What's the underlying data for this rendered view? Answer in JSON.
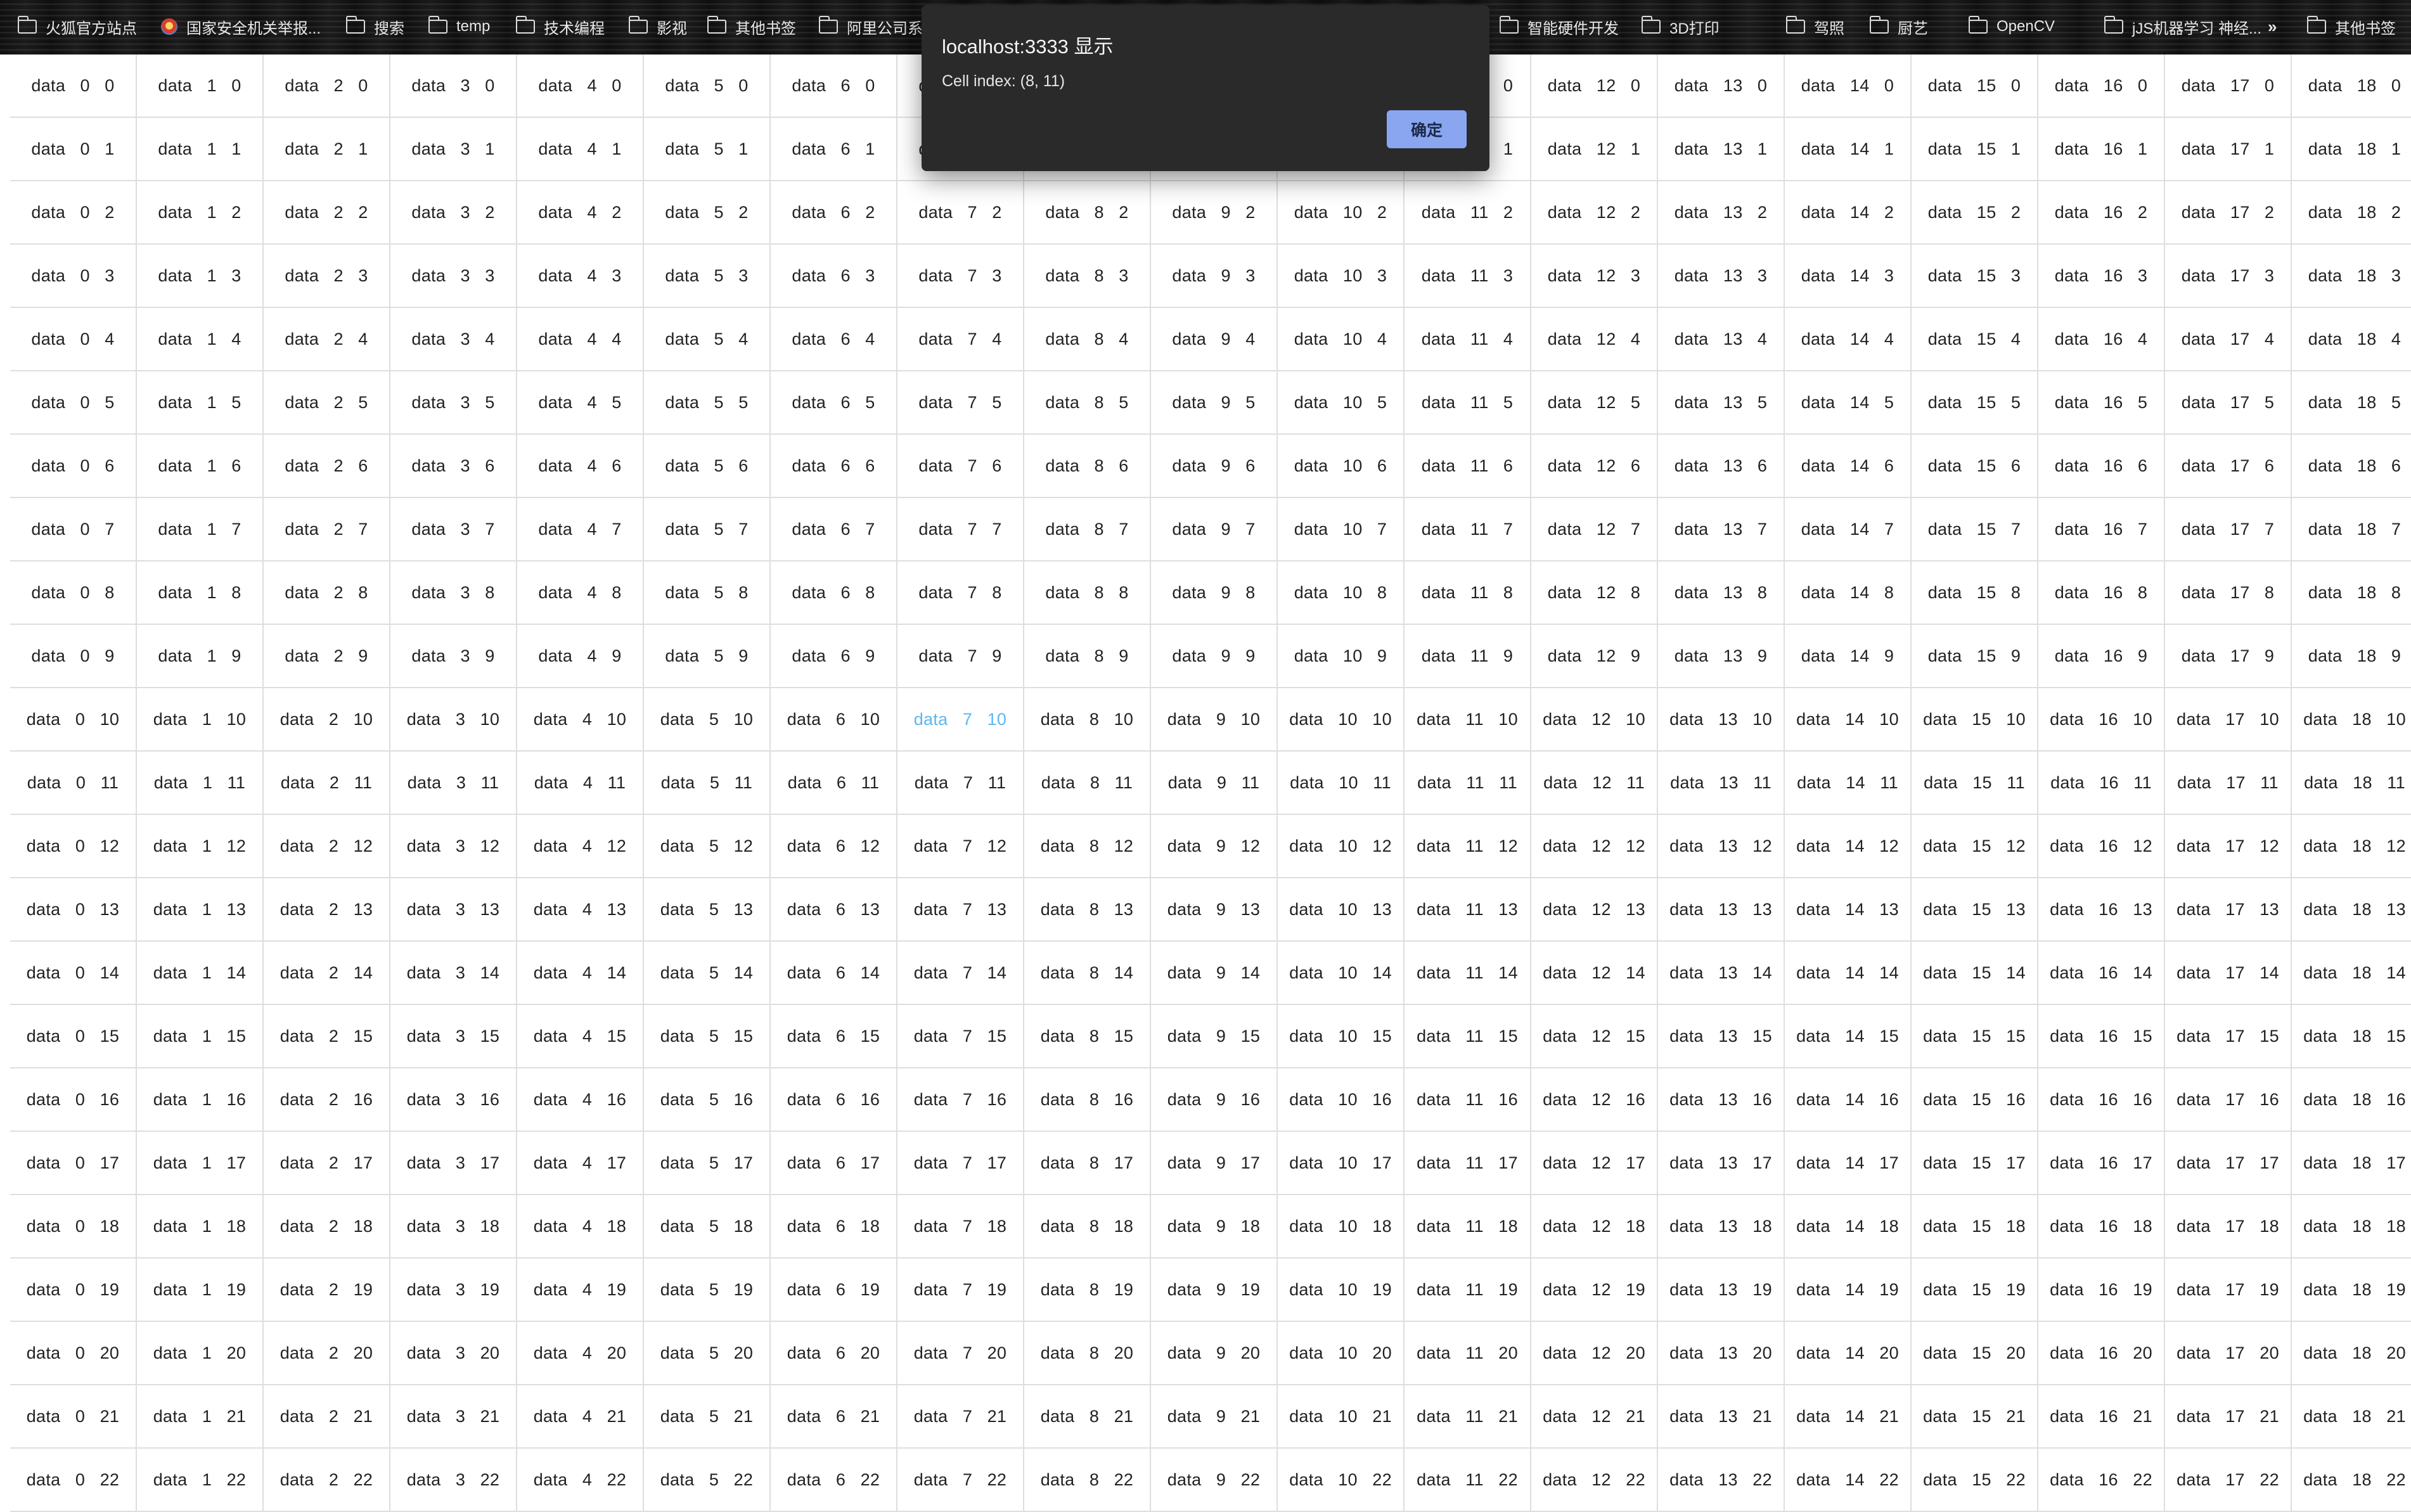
{
  "bookmarks": [
    {
      "label": "火狐官方站点",
      "icon": "folder-icon"
    },
    {
      "label": "国家安全机关举报...",
      "icon": "shield-icon"
    },
    {
      "label": "搜索",
      "icon": "folder-icon"
    },
    {
      "label": "temp",
      "icon": "folder-icon"
    },
    {
      "label": "技术编程",
      "icon": "folder-icon"
    },
    {
      "label": "影视",
      "icon": "folder-icon"
    },
    {
      "label": "其他书签",
      "icon": "folder-icon"
    },
    {
      "label": "阿里公司系",
      "icon": "folder-icon"
    },
    {
      "label": "智能硬件开发",
      "icon": "folder-icon"
    },
    {
      "label": "3D打印",
      "icon": "folder-icon"
    },
    {
      "label": "驾照",
      "icon": "folder-icon"
    },
    {
      "label": "厨艺",
      "icon": "folder-icon"
    },
    {
      "label": "OpenCV",
      "icon": "folder-icon"
    },
    {
      "label": "jJS机器学习 神经...",
      "icon": "folder-icon"
    }
  ],
  "bookmarks_overflow_label": "»",
  "other_bookmarks_label": "其他书签",
  "alert": {
    "title": "localhost:3333 显示",
    "message": "Cell index: (8, 11)",
    "ok_label": "确定"
  },
  "grid": {
    "text_prefix": "data",
    "columns": 19,
    "rows": 23,
    "highlighted_cell": [
      7,
      10
    ],
    "highlight_color": "#5db7ef",
    "text_color": "#222222",
    "border_color": "#dedede"
  }
}
